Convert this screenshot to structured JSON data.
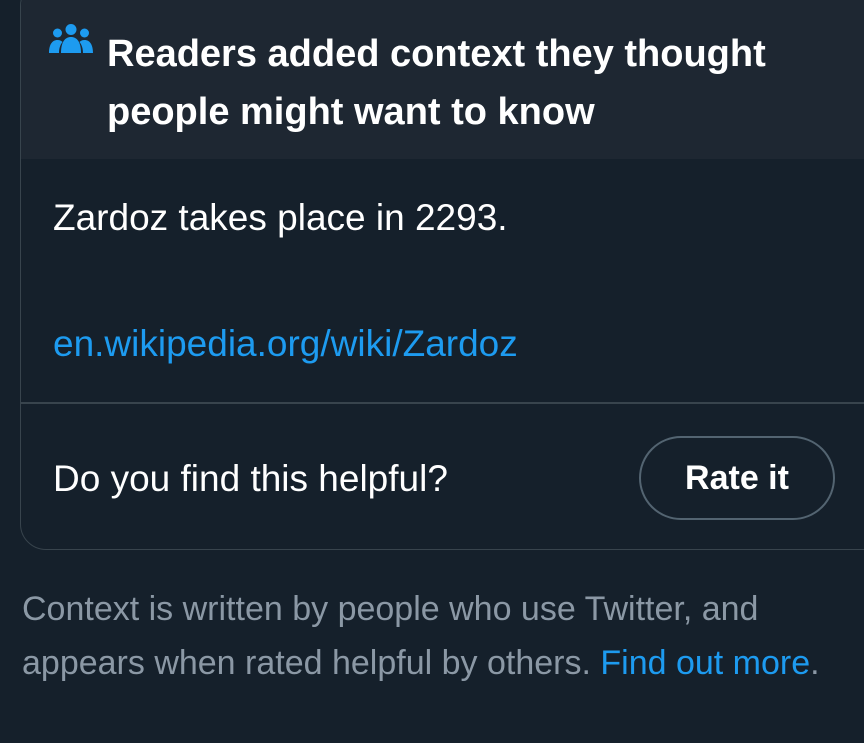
{
  "card": {
    "header_title": "Readers added context they thought people might want to know",
    "header_icon": "people-icon",
    "note_text": "Zardoz takes place in 2293.",
    "link_text": "en.wikipedia.org/wiki/Zardoz",
    "helpful_question": "Do you find this helpful?",
    "rate_button_label": "Rate it"
  },
  "footer": {
    "text": "Context is written by people who use Twitter, and appears when rated helpful by others.",
    "link_text": "Find out more",
    "trailing": "."
  },
  "colors": {
    "background": "#15202b",
    "header_background": "#1e2732",
    "accent": "#1d9bf0",
    "border": "#38444d",
    "muted_text": "#8b98a5"
  }
}
